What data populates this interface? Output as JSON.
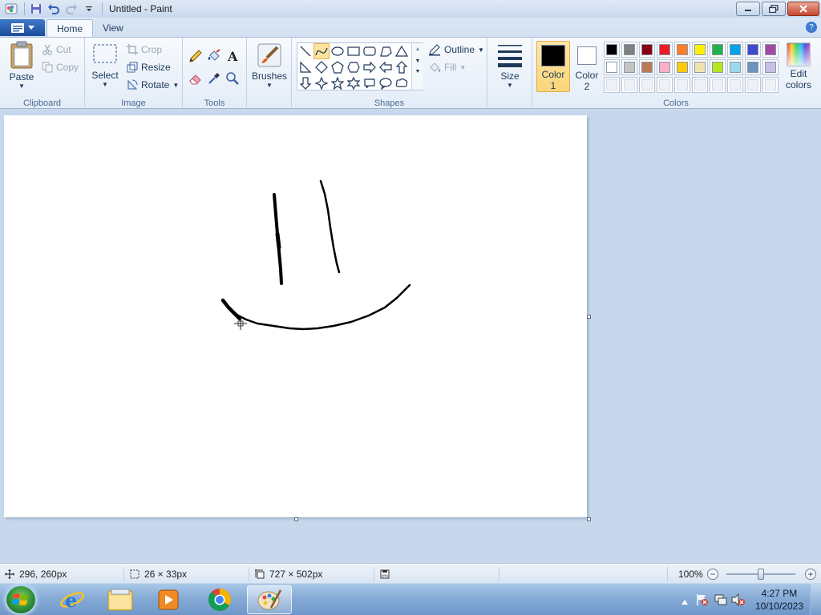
{
  "window": {
    "title": "Untitled - Paint"
  },
  "quick_access": [
    "paint-logo-icon",
    "save-icon",
    "undo-icon",
    "redo-icon",
    "customize-dropdown-icon"
  ],
  "tabs": [
    {
      "label": "Home",
      "active": true
    },
    {
      "label": "View",
      "active": false
    }
  ],
  "ribbon": {
    "clipboard": {
      "label": "Clipboard",
      "paste": "Paste",
      "cut": "Cut",
      "copy": "Copy"
    },
    "image": {
      "label": "Image",
      "select": "Select",
      "crop": "Crop",
      "resize": "Resize",
      "rotate": "Rotate"
    },
    "tools": {
      "label": "Tools",
      "items": [
        "pencil-icon",
        "fill-bucket-icon",
        "text-icon",
        "eraser-icon",
        "color-picker-icon",
        "magnifier-icon"
      ]
    },
    "brushes": {
      "label": "Brushes"
    },
    "shapes": {
      "label": "Shapes",
      "outline": "Outline",
      "fill": "Fill",
      "selected": "curve"
    },
    "size": {
      "label": "Size"
    },
    "colors": {
      "label": "Colors",
      "color1_line1": "Color",
      "color1_line2": "1",
      "color2_line1": "Color",
      "color2_line2": "2",
      "color1": "#000000",
      "color2": "#ffffff",
      "edit_line1": "Edit",
      "edit_line2": "colors",
      "palette_row1": [
        "#000000",
        "#7f7f7f",
        "#880015",
        "#ed1c24",
        "#ff7f27",
        "#fff200",
        "#22b14c",
        "#00a2e8",
        "#3f48cc",
        "#a349a4"
      ],
      "palette_row2": [
        "#ffffff",
        "#c3c3c3",
        "#b97a57",
        "#ffaec9",
        "#ffc90e",
        "#efe4b0",
        "#b5e61d",
        "#99d9ea",
        "#7092be",
        "#c8bfe7"
      ],
      "palette_row3": [
        "",
        "",
        "",
        "",
        "",
        "",
        "",
        "",
        "",
        ""
      ]
    }
  },
  "status": {
    "cursor_position": "296, 260px",
    "selection_size": "26 × 33px",
    "image_size": "727 × 502px",
    "zoom": "100%"
  },
  "taskbar": {
    "apps": [
      "internet-explorer-icon",
      "file-explorer-icon",
      "media-player-icon",
      "chrome-icon",
      "paint-icon"
    ],
    "active_app": "paint-icon",
    "time": "4:27 PM",
    "date": "10/10/2023"
  }
}
